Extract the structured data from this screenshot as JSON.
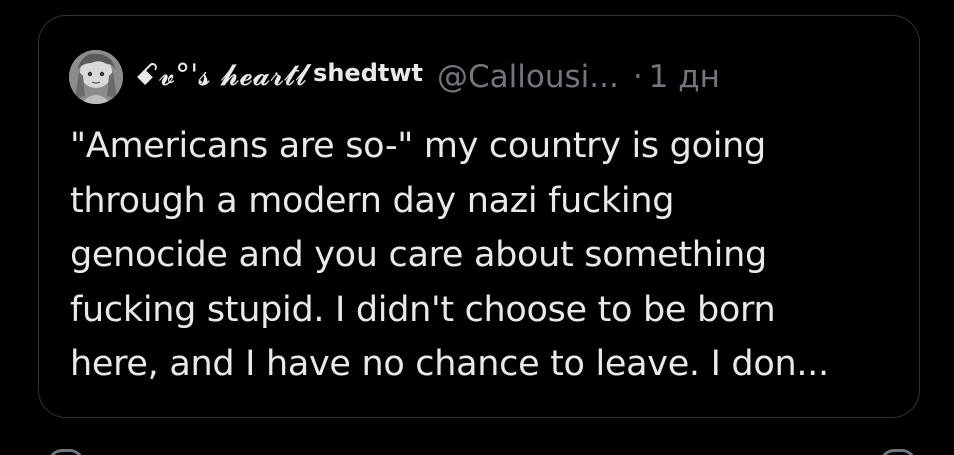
{
  "quoted_post": {
    "author": {
      "display_name": "ꗃ𝓿°'𝓼 𝓱𝓮𝓪𝓻𝓽𝓵",
      "handle_name": "shedtwt",
      "username": "@Callousi...",
      "avatar_icon": "avatar-image"
    },
    "separator": "·",
    "time": "1 дн",
    "text": "\"Americans are so-\" my country is going\nthrough a modern day nazi fucking\ngenocide and you care about something\nfucking stupid. I didn't choose to be born\nhere, and I have no chance to leave. I don..."
  },
  "colors": {
    "background": "#000000",
    "border": "#2f3336",
    "primary_text": "#e7e9ea",
    "secondary_text": "#71767b"
  }
}
